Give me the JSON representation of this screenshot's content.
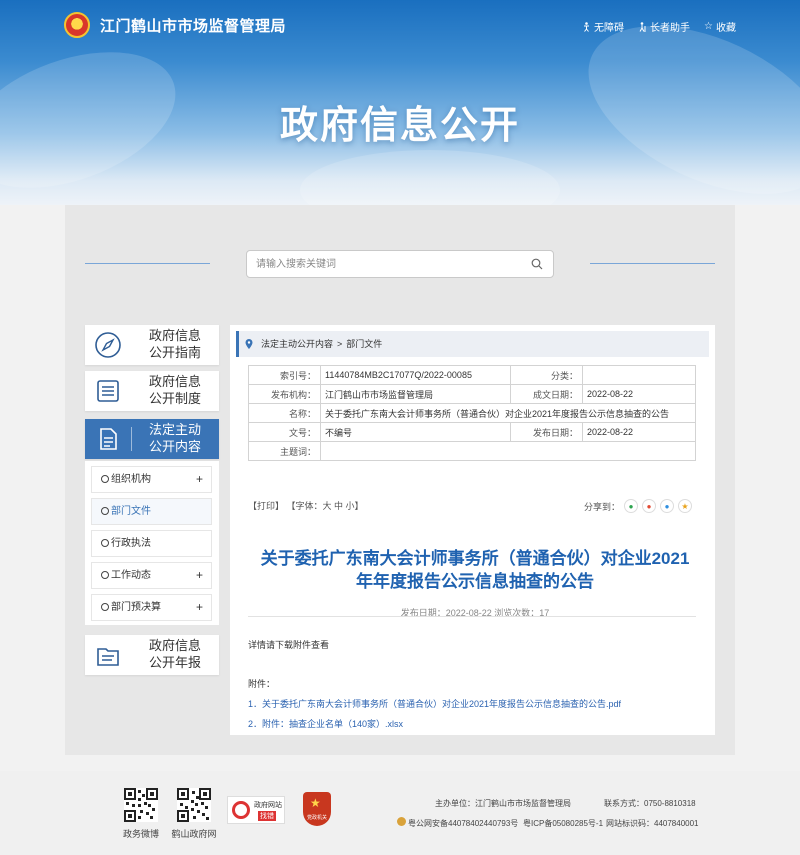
{
  "header": {
    "site_title": "江门鹤山市市场监督管理局",
    "tools": {
      "accessible": "无障碍",
      "elderly": "长者助手",
      "favorite": "收藏"
    },
    "banner_title": "政府信息公开"
  },
  "search": {
    "placeholder": "请输入搜索关键词"
  },
  "sidebar": {
    "cards": [
      {
        "label": "政府信息公开指南",
        "icon": "compass-icon"
      },
      {
        "label": "政府信息公开制度",
        "icon": "list-icon"
      },
      {
        "label": "法定主动公开内容",
        "icon": "document-icon"
      }
    ],
    "sub_items": [
      {
        "label": "组织机构",
        "expandable": "+"
      },
      {
        "label": "部门文件",
        "expandable": ""
      },
      {
        "label": "行政执法",
        "expandable": ""
      },
      {
        "label": "工作动态",
        "expandable": "+"
      },
      {
        "label": "部门预决算",
        "expandable": "+"
      }
    ],
    "annual_report": {
      "label": "政府信息公开年报",
      "icon": "folder-icon"
    }
  },
  "breadcrumb": {
    "level1": "法定主动公开内容",
    "separator": ">",
    "level2": "部门文件"
  },
  "info_table": {
    "index_no_label": "索引号：",
    "index_no": "11440784MB2C17077Q/2022-00085",
    "category_label": "分类：",
    "category": "",
    "publisher_label": "发布机构：",
    "publisher": "江门鹤山市市场监督管理局",
    "created_label": "成文日期：",
    "created": "2022-08-22",
    "name_label": "名称：",
    "name": "关于委托广东南大会计师事务所（普通合伙）对企业2021年度报告公示信息抽查的公告",
    "doc_no_label": "文号：",
    "doc_no": "不编号",
    "published_label": "发布日期：",
    "published": "2022-08-22",
    "subject_label": "主题词：",
    "subject": ""
  },
  "tools": {
    "print": "【打印】",
    "font": "【字体：大 中 小】",
    "share_label": "分享到："
  },
  "article": {
    "title": "关于委托广东南大会计师事务所（普通合伙）对企业2021年年度报告公示信息抽查的公告",
    "meta": "发布日期：2022-08-22  浏览次数：17",
    "body": "详情请下载附件查看",
    "attachments_label": "附件：",
    "attachments": [
      "1．关于委托广东南大会计师事务所（普通合伙）对企业2021年度报告公示信息抽查的公告.pdf",
      "2．附件：抽查企业名单（140家）.xlsx"
    ]
  },
  "footer": {
    "qr1_label": "政务微博",
    "qr2_label": "鹤山政府网",
    "gov_badge_line1": "政府网站",
    "gov_badge_line2": "找错",
    "party_badge": "党政机关",
    "sponsor": "主办单位：江门鹤山市市场监督管理局",
    "contact": "联系方式：0750-8810318",
    "police": "粤公网安备44078402440793号",
    "icp": "粤ICP备05080285号-1",
    "site_code": "网站标识码：4407840001"
  },
  "colors": {
    "brand_blue": "#3a74b6",
    "title_blue": "#1f62b0"
  }
}
